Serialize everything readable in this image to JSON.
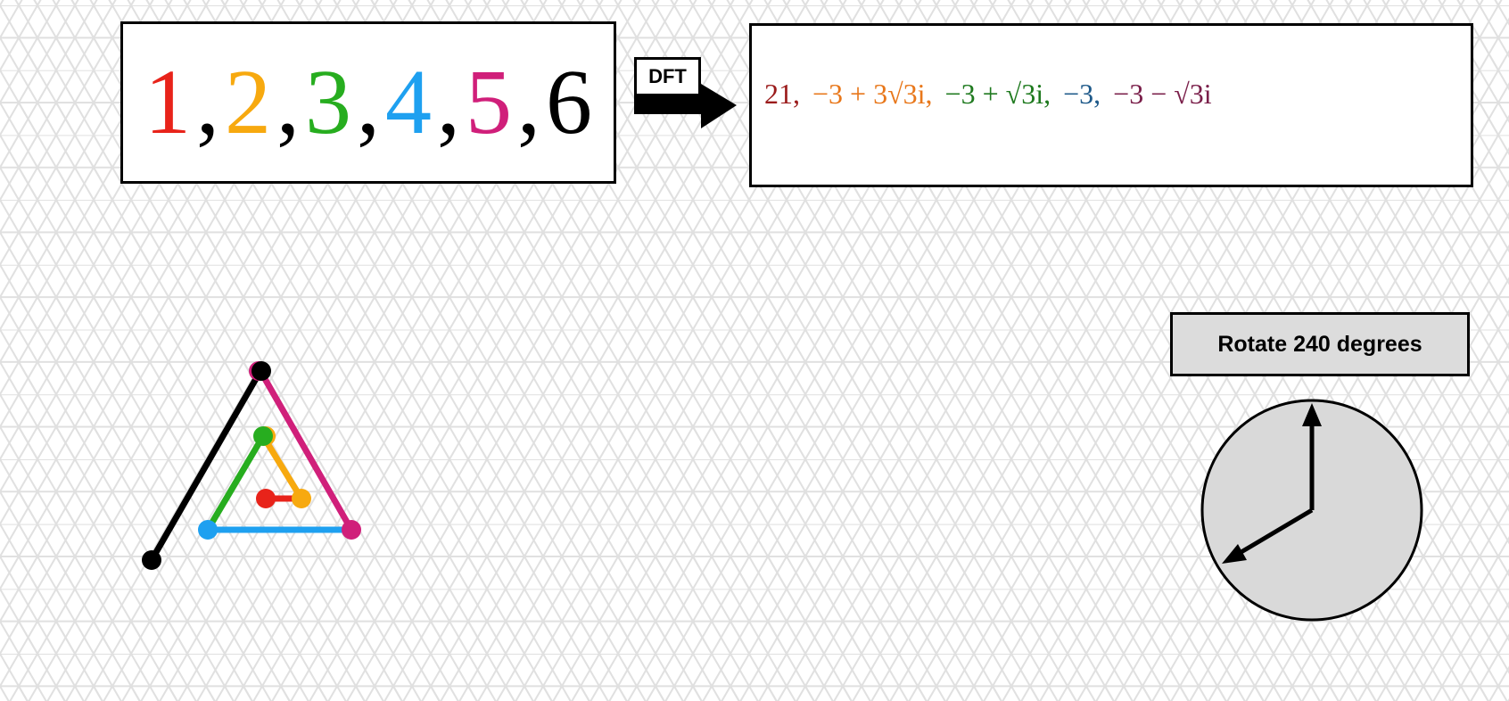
{
  "input_sequence": [
    {
      "text": "1",
      "color": "#e8231a"
    },
    {
      "text": "2",
      "color": "#f7a90f"
    },
    {
      "text": "3",
      "color": "#27ad1f"
    },
    {
      "text": "4",
      "color": "#1ea0f0"
    },
    {
      "text": "5",
      "color": "#d01f7a"
    },
    {
      "text": "6",
      "color": "#000000"
    }
  ],
  "separator": ",",
  "dft_label": "DFT",
  "output_terms": [
    {
      "text": "21,",
      "color": "#9b1c1c"
    },
    {
      "text": "−3 + 3√3i,",
      "color": "#e8771a"
    },
    {
      "text": "−3 + √3i,",
      "color": "#1f7a1f"
    },
    {
      "text": "−3,",
      "color": "#1f5a8a"
    },
    {
      "text": "−3 − √3i",
      "color": "#7a1f4a"
    }
  ],
  "rotate_label": "Rotate 240 degrees",
  "colors": {
    "grid": "#e2e2e2",
    "clock_face": "#d9d9d9"
  }
}
